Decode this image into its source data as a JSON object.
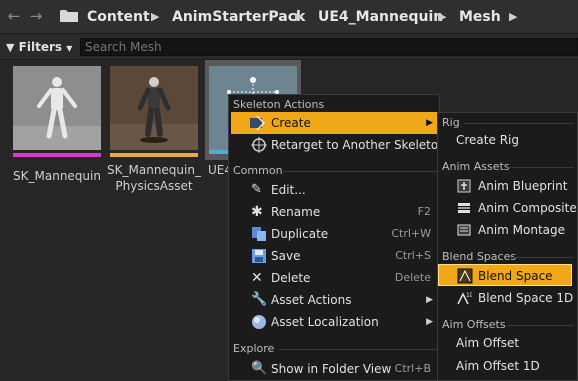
{
  "breadcrumb": [
    "Content",
    "AnimStarterPack",
    "UE4_Mannequin",
    "Mesh"
  ],
  "nav": {
    "back_icon": "back-arrow-icon",
    "forward_icon": "forward-arrow-icon"
  },
  "filters": {
    "label": "Filters",
    "search_placeholder": "Search Mesh"
  },
  "assets": [
    {
      "name": "SK_Mannequin",
      "thumb_color": "#8c8c8c",
      "strip_color": "#d73ad1"
    },
    {
      "name": "SK_Mannequin_PhysicsAsset",
      "line2": "PhysicsAsset",
      "thumb_color": "#5a4a3a",
      "strip_color": "#e6a84a"
    },
    {
      "name": "UE4",
      "thumb_color": "#6e8890",
      "strip_color": "#4cb0d0"
    }
  ],
  "context_menu": {
    "sections": {
      "skeleton_actions": "Skeleton Actions",
      "common": "Common",
      "explore": "Explore"
    },
    "items": {
      "create": "Create",
      "retarget": "Retarget to Another Skeleton",
      "edit": "Edit...",
      "rename": "Rename",
      "rename_shortcut": "F2",
      "duplicate": "Duplicate",
      "duplicate_shortcut": "Ctrl+W",
      "save": "Save",
      "save_shortcut": "Ctrl+S",
      "delete": "Delete",
      "delete_shortcut": "Delete",
      "asset_actions": "Asset Actions",
      "asset_localization": "Asset Localization",
      "show_in_folder": "Show in Folder View",
      "show_in_folder_shortcut": "Ctrl+B"
    }
  },
  "submenu": {
    "sections": {
      "rig": "Rig",
      "anim_assets": "Anim Assets",
      "blend_spaces": "Blend Spaces",
      "aim_offsets": "Aim Offsets"
    },
    "items": {
      "create_rig": "Create Rig",
      "anim_blueprint": "Anim Blueprint",
      "anim_composite": "Anim Composite",
      "anim_montage": "Anim Montage",
      "blend_space": "Blend Space",
      "blend_space_1d": "Blend Space 1D",
      "aim_offset": "Aim Offset",
      "aim_offset_1d": "Aim Offset 1D"
    }
  },
  "colors": {
    "highlight": "#f0a818",
    "menu_bg": "#1b1b1b"
  }
}
